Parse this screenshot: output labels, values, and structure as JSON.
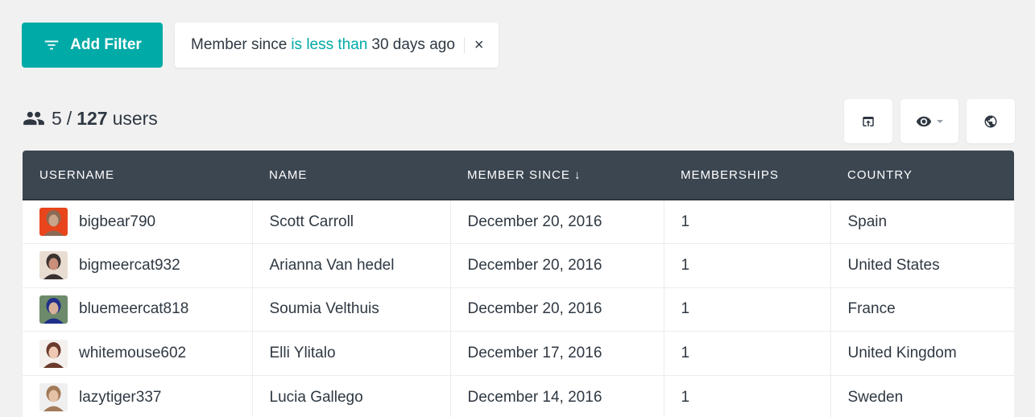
{
  "filter_bar": {
    "add_filter_label": "Add Filter",
    "active_filter": {
      "field": "Member since",
      "operator": "is less than",
      "value": "30 days ago"
    },
    "remove_filter_icon": "×"
  },
  "summary": {
    "shown": "5",
    "separator": "/",
    "total": "127",
    "unit": "users"
  },
  "toolbar": {
    "buttons": [
      {
        "name": "export",
        "icon": "export-icon"
      },
      {
        "name": "view-columns",
        "icon": "eye-icon",
        "has_dropdown": true
      },
      {
        "name": "country-view",
        "icon": "globe-icon"
      }
    ]
  },
  "table": {
    "columns": [
      "USERNAME",
      "NAME",
      "MEMBER SINCE ↓",
      "MEMBERSHIPS",
      "COUNTRY"
    ],
    "sorted_by": "MEMBER SINCE",
    "sort_direction": "descending",
    "rows": [
      {
        "username": "bigbear790",
        "name": "Scott Carroll",
        "member_since": "December 20, 2016",
        "memberships": "1",
        "country": "Spain",
        "avatar_colors": [
          "#e8451d",
          "#8a6a55",
          "#c9a48a"
        ]
      },
      {
        "username": "bigmeercat932",
        "name": "Arianna Van hedel",
        "member_since": "December 20, 2016",
        "memberships": "1",
        "country": "United States",
        "avatar_colors": [
          "#e9ddd2",
          "#3a3230",
          "#c98f7a"
        ]
      },
      {
        "username": "bluemeercat818",
        "name": "Soumia Velthuis",
        "member_since": "December 20, 2016",
        "memberships": "1",
        "country": "France",
        "avatar_colors": [
          "#6d8a6a",
          "#1f2f8a",
          "#d7b19a"
        ]
      },
      {
        "username": "whitemouse602",
        "name": "Elli Ylitalo",
        "member_since": "December 17, 2016",
        "memberships": "1",
        "country": "United Kingdom",
        "avatar_colors": [
          "#f3f0ee",
          "#6b3a2c",
          "#efc9b4"
        ]
      },
      {
        "username": "lazytiger337",
        "name": "Lucia Gallego",
        "member_since": "December 14, 2016",
        "memberships": "1",
        "country": "Sweden",
        "avatar_colors": [
          "#efefef",
          "#a27a58",
          "#e5c1a6"
        ]
      }
    ]
  },
  "colors": {
    "accent": "#00aaa6",
    "header_bg": "#3b4651",
    "text": "#2f3842",
    "page_bg": "#f1f1f1"
  }
}
